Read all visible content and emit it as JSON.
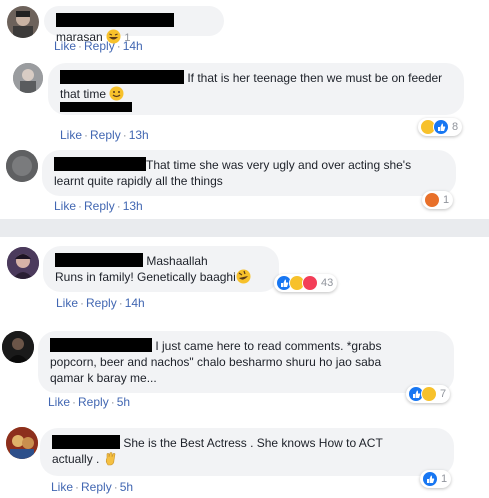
{
  "colors": {
    "link": "#4267b2",
    "meta": "#90949c",
    "bubble": "#f2f3f5",
    "separator": "#e9ebee"
  },
  "comments": [
    {
      "text": "marasan",
      "like": "Like",
      "reply": "Reply",
      "time": "14h",
      "reaction_count": "1",
      "reactions": [
        "haha-icon"
      ]
    },
    {
      "text": "If that is her teenage then we must be on feeder that time",
      "like": "Like",
      "reply": "Reply",
      "time": "13h",
      "reaction_count": "8",
      "reactions": [
        "haha-icon",
        "like-icon"
      ]
    },
    {
      "text": "That time she was very ugly and over acting she's learnt quite rapidly all the things",
      "like": "Like",
      "reply": "Reply",
      "time": "13h",
      "reaction_count": "1",
      "reactions": [
        "angry-icon"
      ]
    },
    {
      "line1": "Mashaallah",
      "line2": "Runs in family! Genetically baaghi",
      "like": "Like",
      "reply": "Reply",
      "time": "14h",
      "reaction_count": "43",
      "reactions": [
        "like-icon",
        "haha-icon",
        "love-icon"
      ]
    },
    {
      "line1": "I just came here to read comments. *grabs",
      "line2": "popcorn, beer and nachos\" chalo besharmo shuru ho jao saba",
      "line3": "qamar k baray me...",
      "like": "Like",
      "reply": "Reply",
      "time": "5h",
      "reaction_count": "7",
      "reactions": [
        "like-icon",
        "haha-icon"
      ]
    },
    {
      "line1": "She is the Best Actress . She knows How to ACT",
      "line2": "actually .",
      "like": "Like",
      "reply": "Reply",
      "time": "5h",
      "reaction_count": "1",
      "reactions": [
        "like-icon"
      ]
    }
  ]
}
